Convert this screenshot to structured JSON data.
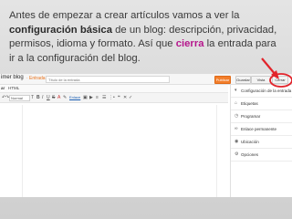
{
  "caption": {
    "part1": " Antes de empezar a crear artículos vamos a ver la ",
    "bold1": "configuración básica",
    "part2": " de un blog: descripción, privacidad, permisos, idioma y formato. Así que ",
    "highlight": "cierra",
    "part3": " la entrada para ir a la configuración del blog."
  },
  "topbar": {
    "blog_name": "imer blog",
    "crumb": "· Entrada ·",
    "title_placeholder": "Título de la entrada",
    "publish_label": "Publicar",
    "save_label": "Guardar",
    "preview_label": "Vista previa",
    "close_label": "Cerrar"
  },
  "modes": {
    "compose": "ar",
    "html": "HTML"
  },
  "toolbar": {
    "font_select": "Normal",
    "bold": "B",
    "italic": "I",
    "underline": "U",
    "strike": "S",
    "link_label": "Enlace"
  },
  "sidebar": {
    "header": "Configuración de la entrada",
    "items": [
      {
        "icon": "tag-icon",
        "label": "Etiquetas"
      },
      {
        "icon": "clock-icon",
        "label": "Programar"
      },
      {
        "icon": "link-icon",
        "label": "Enlace permanente"
      },
      {
        "icon": "location-icon",
        "label": "Ubicación"
      },
      {
        "icon": "gear-icon",
        "label": "Opciones"
      }
    ]
  },
  "colors": {
    "publish": "#f27e2b",
    "highlight": "#b5178c",
    "arrow": "#e2242b"
  }
}
